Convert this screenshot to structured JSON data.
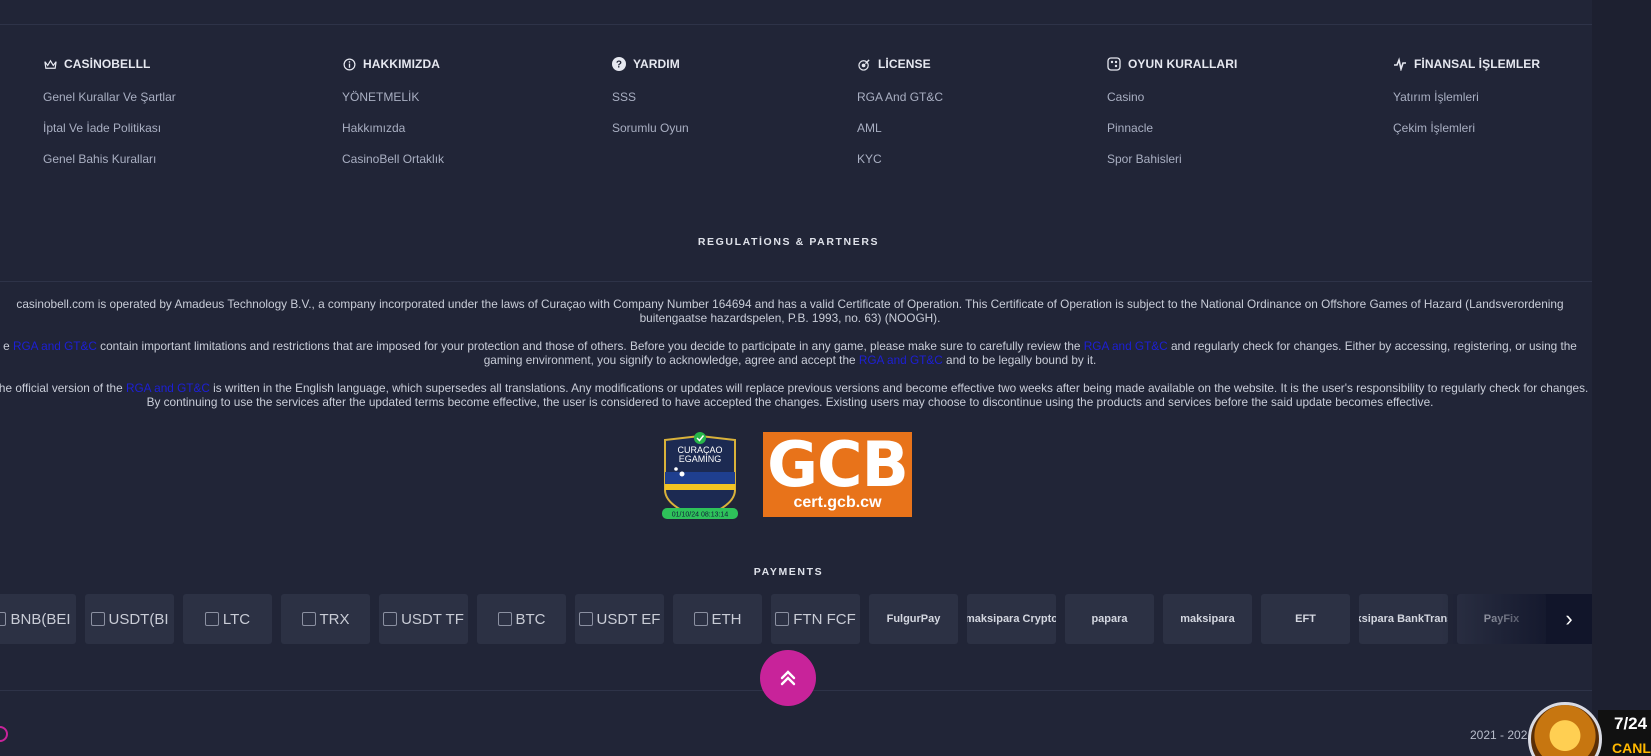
{
  "columns": [
    {
      "icon": "crown-icon",
      "title": "CASİNOBELLL",
      "links": [
        "Genel Kurallar Ve Şartlar",
        "İptal Ve İade Politikası",
        "Genel Bahis Kuralları"
      ]
    },
    {
      "icon": "info-icon",
      "title": "HAKKIMIZDA",
      "links": [
        "YÖNETMELİK",
        "Hakkımızda",
        "CasinoBell Ortaklık"
      ]
    },
    {
      "icon": "question-icon",
      "title": "YARDIM",
      "links": [
        "SSS",
        "Sorumlu Oyun"
      ]
    },
    {
      "icon": "license-icon",
      "title": "LİCENSE",
      "links": [
        "RGA And GT&C",
        "AML",
        "KYC"
      ]
    },
    {
      "icon": "dice-icon",
      "title": "OYUN KURALLARI",
      "links": [
        "Casino",
        "Pinnacle",
        "Spor Bahisleri"
      ]
    },
    {
      "icon": "finance-icon",
      "title": "FİNANSAL İŞLEMLER",
      "links": [
        "Yatırım İşlemleri",
        "Çekim İşlemleri"
      ]
    }
  ],
  "regulations": {
    "title": "REGULATİONS & PARTNERS",
    "p1": "casinobell.com is operated by Amadeus Technology B.V., a company incorporated under the laws of Curaçao with Company Number 164694 and has a valid Certificate of Operation. This Certificate of Operation is subject to the National Ordinance on Offshore Games of Hazard (Landsverordening buitengaatse hazardspelen, P.B. 1993, no. 63) (NOOGH).",
    "p2_a": "e ",
    "p2_link1": "RGA and GT&C",
    "p2_b": " contain important limitations and restrictions that are imposed for your protection and those of others. Before you decide to participate in any game, please make sure to carefully review the ",
    "p2_link2": "RGA and GT&C",
    "p2_c": " and regularly check for changes. Either by accessing, registering, or using the gaming environment, you signify to acknowledge, agree and accept the ",
    "p2_link3": "RGA and GT&C",
    "p2_d": " and to be legally bound by it.",
    "p3_a": "The official version of the ",
    "p3_link": "RGA and GT&C",
    "p3_b": " is written in the English language, which supersedes all translations. Any modifications or updates will replace previous versions and become effective two weeks after being made available on the website. It is the user's responsibility to regularly check for changes. By continuing to use the services after the updated terms become effective, the user is considered to have accepted the changes. Existing users may choose to discontinue using the products and services before the said update becomes effective."
  },
  "badges": {
    "curacao_line1": "CURAÇAO",
    "curacao_line2": "EGAMING",
    "curacao_date": "01/10/24  08:13:14",
    "gcb_big": "GCB",
    "gcb_small": "cert.gcb.cw"
  },
  "payments": {
    "title": "PAYMENTS",
    "items": [
      {
        "label": "BNB(BEI",
        "type": "broken"
      },
      {
        "label": "USDT(BI",
        "type": "broken"
      },
      {
        "label": "LTC",
        "type": "broken"
      },
      {
        "label": "TRX",
        "type": "broken"
      },
      {
        "label": "USDT TF",
        "type": "broken"
      },
      {
        "label": "BTC",
        "type": "broken"
      },
      {
        "label": "USDT EF",
        "type": "broken"
      },
      {
        "label": "ETH",
        "type": "broken"
      },
      {
        "label": "FTN FCF",
        "type": "broken"
      },
      {
        "label": "FulgurPay",
        "type": "logo"
      },
      {
        "label": "maksipara Crypto",
        "type": "logo"
      },
      {
        "label": "papara",
        "type": "logo"
      },
      {
        "label": "maksipara",
        "type": "logo"
      },
      {
        "label": "EFT",
        "type": "logo"
      },
      {
        "label": "maksipara BankTransfer",
        "type": "logo"
      },
      {
        "label": "PayFix",
        "type": "logo"
      }
    ]
  },
  "footer": {
    "copyright": "2021 - 202",
    "live_count": "7/24",
    "live_label": "CANL"
  }
}
